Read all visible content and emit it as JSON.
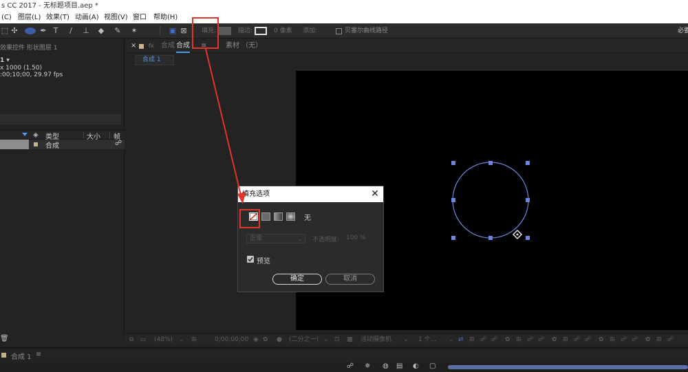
{
  "window": {
    "title": "s CC 2017 - 无标题项目.aep *"
  },
  "menu": {
    "items": [
      "(C)",
      "图层(L)",
      "效果(T)",
      "动画(A)",
      "视图(V)",
      "窗口",
      "帮助(H)"
    ]
  },
  "toolbar": {
    "fill_label": "填充:",
    "stroke_label": "描边:",
    "stroke_width": "0 像素",
    "add_label": "添加:",
    "bezier_label": "贝塞尔曲线路径",
    "workspace": "必要"
  },
  "left_panel": {
    "title": "效果控件 形状图层 1",
    "comp_name": "1 ▾",
    "dims": "x 1000 (1.50)",
    "duration": ":00;10;00, 29.97 fps",
    "columns": {
      "type": "类型",
      "size": "大小",
      "frame": "帧"
    },
    "row": {
      "type": "合成"
    }
  },
  "comp_panel": {
    "close": "×",
    "lock": "fx",
    "comp_prefix": "合成",
    "comp_tab": "合成",
    "menu_glyph": "≡",
    "footage_tab": "素材 （无）",
    "subtab": "合成 1"
  },
  "dialog": {
    "title": "填充选项",
    "close": "✕",
    "none_label": "无",
    "mode": "正常",
    "opacity_label": "不透明度:",
    "opacity_value": "100 %",
    "preview_label": "预览",
    "ok": "确定",
    "cancel": "取消"
  },
  "viewer_bar": {
    "zoom": "(48%)",
    "timecode": "0;00;00;00",
    "resolution": "(二分之一)",
    "camera": "活动摄像机",
    "views": "1 个..."
  },
  "timeline": {
    "tab": "合成 1",
    "menu_glyph": "≡"
  },
  "colors": {
    "accent_blue": "#4a9bf0",
    "path_color": "#6f86e0",
    "annotation_red": "#e0362c"
  }
}
